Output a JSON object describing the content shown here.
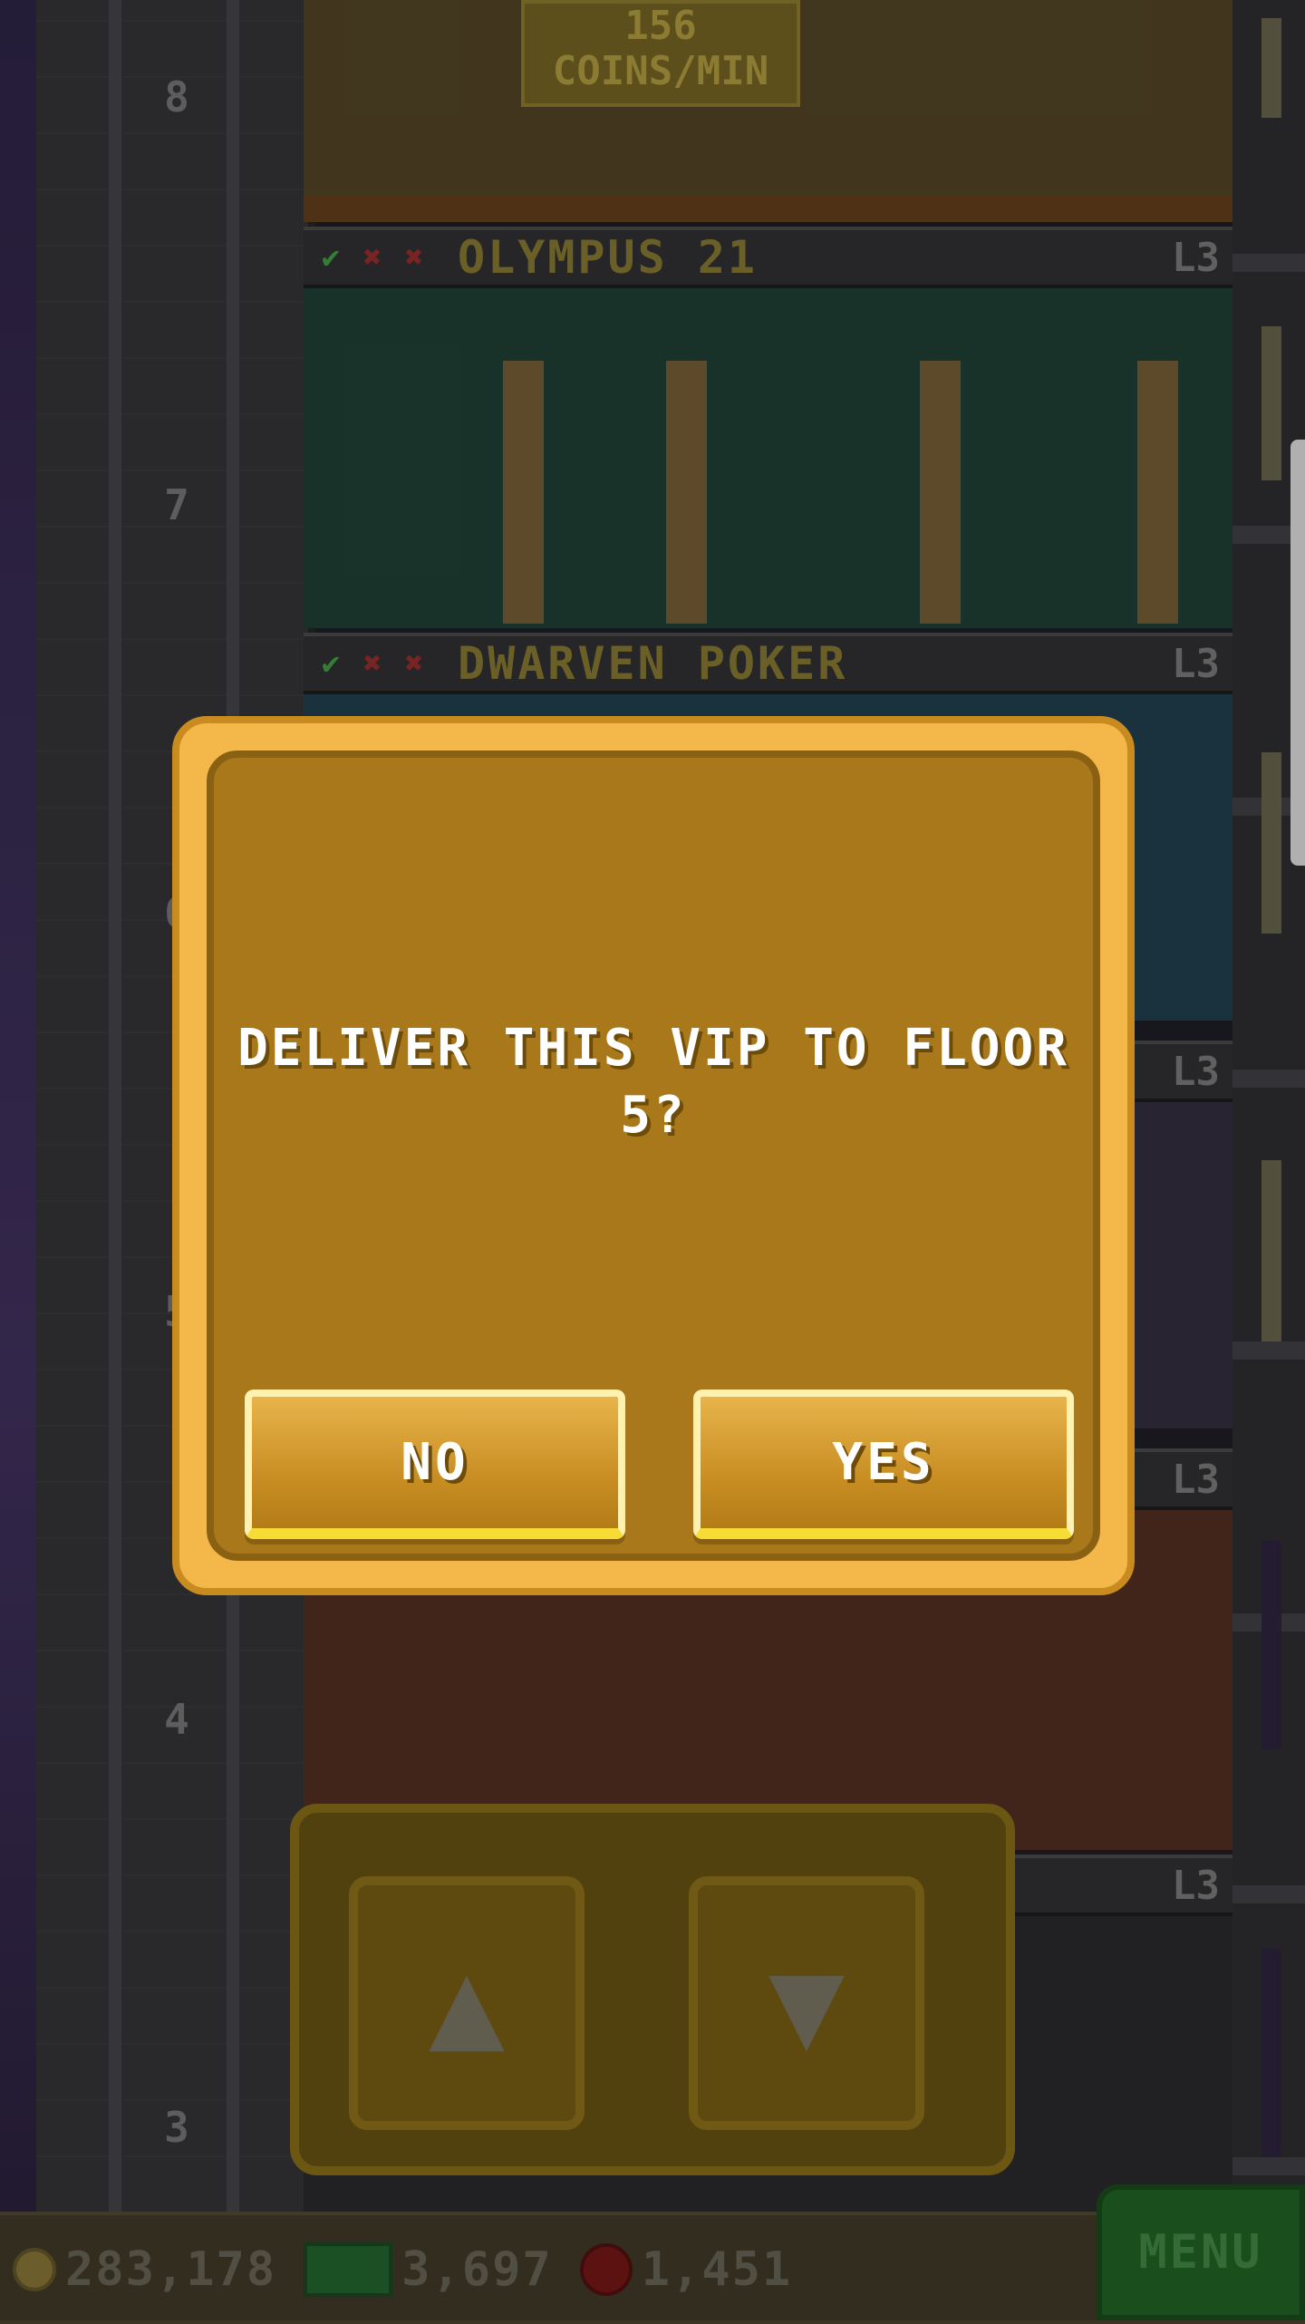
{
  "floors": [
    {
      "number": "8"
    },
    {
      "number": "7",
      "name": "OLYMPUS 21",
      "level": "L3"
    },
    {
      "number": "6",
      "name": "DWARVEN POKER",
      "level": "L3"
    },
    {
      "number": "5",
      "level": "L3"
    },
    {
      "number": "4",
      "level": "L3"
    },
    {
      "number": "3",
      "level": "L3"
    }
  ],
  "top_floor": {
    "rate_value": "156",
    "rate_unit": "COINS/MIN"
  },
  "status_marks": {
    "ok": "✔",
    "bad": "✖"
  },
  "dialog": {
    "message": "DELIVER THIS VIP TO FLOOR 5?",
    "no_label": "NO",
    "yes_label": "YES"
  },
  "elevator": {
    "up_icon": "▲",
    "down_icon": "▼"
  },
  "bottom_bar": {
    "coins": "283,178",
    "cash": "3,697",
    "bux": "1,451",
    "menu_label": "MENU"
  },
  "colors": {
    "dialog_outer": "#f3b74a",
    "dialog_inner": "#a8781a",
    "button_highlight": "#f7dc36",
    "menu_green": "#1e5a22"
  }
}
